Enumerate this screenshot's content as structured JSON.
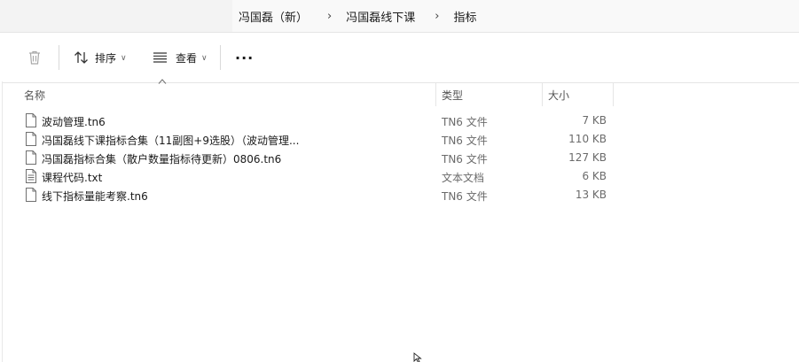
{
  "breadcrumb": [
    "冯国磊（新）",
    "冯国磊线下课",
    "指标"
  ],
  "toolbar": {
    "delete_icon": "trash-icon",
    "sort_label": "排序",
    "view_label": "查看",
    "more_label": "···"
  },
  "columns": {
    "name": "名称",
    "type": "类型",
    "size": "大小"
  },
  "files": [
    {
      "name": "波动管理.tn6",
      "type": "TN6 文件",
      "size": "7 KB",
      "icon": "document-icon"
    },
    {
      "name": "冯国磊线下课指标合集（11副图+9选股）（波动管理...",
      "type": "TN6 文件",
      "size": "110 KB",
      "icon": "document-icon"
    },
    {
      "name": "冯国磊指标合集（散户数量指标待更新）0806.tn6",
      "type": "TN6 文件",
      "size": "127 KB",
      "icon": "document-icon"
    },
    {
      "name": "课程代码.txt",
      "type": "文本文档",
      "size": "6 KB",
      "icon": "text-document-icon"
    },
    {
      "name": "线下指标量能考察.tn6",
      "type": "TN6 文件",
      "size": "13 KB",
      "icon": "document-icon"
    }
  ]
}
